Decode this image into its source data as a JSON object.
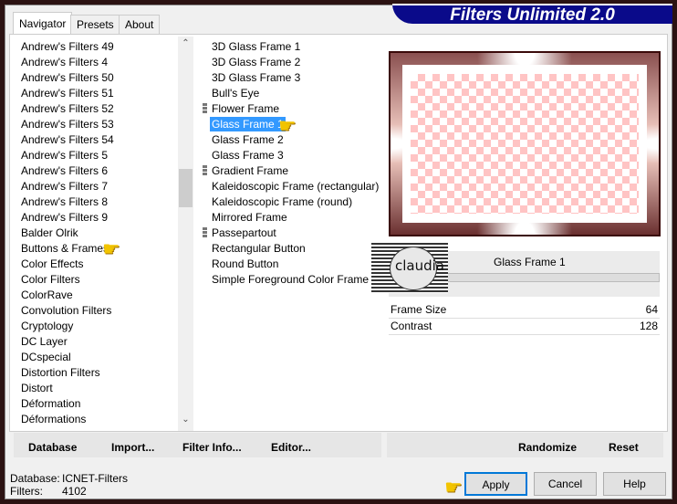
{
  "app": {
    "title": "Filters Unlimited 2.0"
  },
  "tabs": [
    {
      "label": "Navigator",
      "active": true
    },
    {
      "label": "Presets"
    },
    {
      "label": "About"
    }
  ],
  "categories": [
    "Andrew's Filters 49",
    "Andrew's Filters 4",
    "Andrew's Filters 50",
    "Andrew's Filters 51",
    "Andrew's Filters 52",
    "Andrew's Filters 53",
    "Andrew's Filters 54",
    "Andrew's Filters 5",
    "Andrew's Filters 6",
    "Andrew's Filters 7",
    "Andrew's Filters 8",
    "Andrew's Filters 9",
    "Balder Olrik",
    "Buttons & Frames",
    "Color Effects",
    "Color Filters",
    "ColorRave",
    "Convolution Filters",
    "Cryptology",
    "DC Layer",
    "DCspecial",
    "Distortion Filters",
    "Distort",
    "Déformation",
    "Déformations"
  ],
  "selected_category": "Buttons & Frames",
  "filters": [
    {
      "label": "3D Glass Frame 1"
    },
    {
      "label": "3D Glass Frame 2"
    },
    {
      "label": "3D Glass Frame 3"
    },
    {
      "label": "Bull's Eye"
    },
    {
      "label": "Flower Frame",
      "grip": true
    },
    {
      "label": "Glass Frame 1",
      "selected": true
    },
    {
      "label": "Glass Frame 2"
    },
    {
      "label": "Glass Frame 3"
    },
    {
      "label": "Gradient Frame",
      "grip": true
    },
    {
      "label": "Kaleidoscopic Frame (rectangular)"
    },
    {
      "label": "Kaleidoscopic Frame (round)"
    },
    {
      "label": "Mirrored Frame"
    },
    {
      "label": "Passepartout",
      "grip": true
    },
    {
      "label": "Rectangular Button"
    },
    {
      "label": "Round Button"
    },
    {
      "label": "Simple Foreground Color Frame"
    }
  ],
  "preview": {
    "filter_name": "Glass Frame 1",
    "watermark": "claudia"
  },
  "params": [
    {
      "name": "Frame Size",
      "value": "64",
      "level": 0.25
    },
    {
      "name": "Contrast",
      "value": "128",
      "level": 0.5
    }
  ],
  "buttons": {
    "database": "Database",
    "import": "Import...",
    "filter_info": "Filter Info...",
    "editor": "Editor...",
    "randomize": "Randomize",
    "reset": "Reset",
    "apply": "Apply",
    "cancel": "Cancel",
    "help": "Help"
  },
  "status": {
    "database_label": "Database:",
    "database_value": "ICNET-Filters",
    "filters_label": "Filters:",
    "filters_value": "4102"
  },
  "colors": {
    "selection": "#3399ff",
    "banner": "#0a0a8a",
    "checker": "#ffc4c4",
    "frame": "#3a0a0a"
  },
  "icons": {
    "pointer": "pointing-hand-icon"
  }
}
